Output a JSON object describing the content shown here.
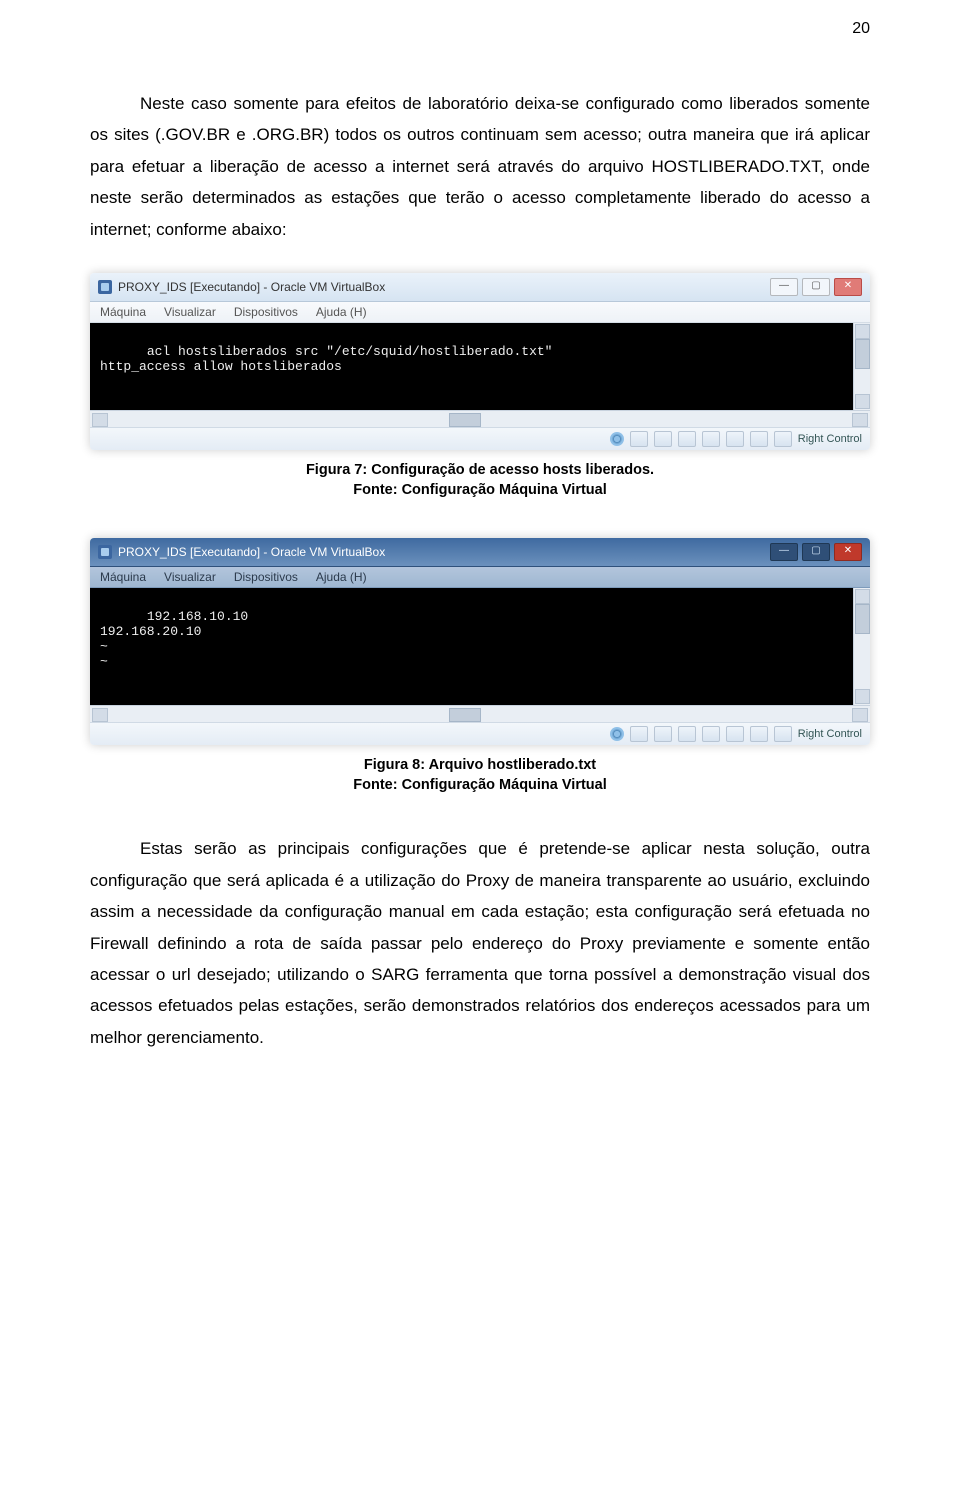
{
  "page_number": "20",
  "paragraph1": "Neste caso somente para efeitos de laboratório deixa-se configurado como liberados somente os sites (.GOV.BR e .ORG.BR) todos os outros continuam sem acesso; outra maneira que irá aplicar para efetuar a liberação de acesso a internet será através do arquivo HOSTLIBERADO.TXT, onde neste serão determinados as estações que terão o acesso completamente liberado do acesso a internet; conforme abaixo:",
  "paragraph2": "Estas serão as principais configurações que é pretende-se aplicar nesta solução, outra configuração que será aplicada é a utilização do Proxy de maneira transparente ao usuário, excluindo assim a necessidade da configuração manual em cada estação; esta configuração será efetuada no Firewall definindo a rota de saída passar pelo endereço do Proxy previamente e somente então acessar o url desejado; utilizando o SARG ferramenta que torna possível a demonstração visual dos acessos efetuados pelas estações, serão demonstrados relatórios dos endereços acessados para um melhor gerenciamento.",
  "fig7": {
    "window_title": "PROXY_IDS [Executando] - Oracle VM VirtualBox",
    "menu": [
      "Máquina",
      "Visualizar",
      "Dispositivos",
      "Ajuda (H)"
    ],
    "terminal_lines": "acl hostsliberados src \"/etc/squid/hostliberado.txt\"\nhttp_access allow hotsliberados",
    "status_label": "Right Control",
    "caption": "Figura 7: Configuração de acesso hosts liberados.",
    "source": "Fonte: Configuração Máquina Virtual"
  },
  "fig8": {
    "window_title": "PROXY_IDS [Executando] - Oracle VM VirtualBox",
    "menu": [
      "Máquina",
      "Visualizar",
      "Dispositivos",
      "Ajuda (H)"
    ],
    "terminal_lines": "192.168.10.10\n192.168.20.10\n~\n~",
    "status_label": "Right Control",
    "caption": "Figura 8: Arquivo hostliberado.txt",
    "source": "Fonte: Configuração Máquina Virtual"
  }
}
